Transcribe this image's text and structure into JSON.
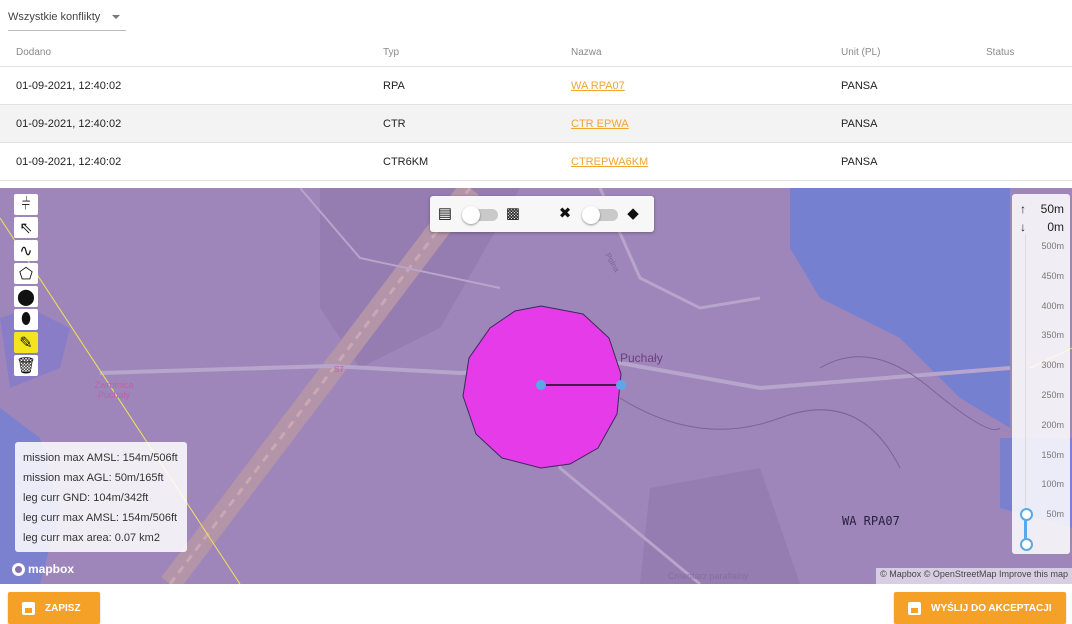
{
  "filter": {
    "label": "Wszystkie konflikty"
  },
  "table": {
    "headers": [
      "Dodano",
      "Typ",
      "Nazwa",
      "Unit (PL)",
      "Status"
    ],
    "rows": [
      {
        "date": "01-09-2021, 12:40:02",
        "type": "RPA",
        "name": "WA RPA07",
        "unit": "PANSA",
        "status": ""
      },
      {
        "date": "01-09-2021, 12:40:02",
        "type": "CTR",
        "name": "CTR EPWA",
        "unit": "PANSA",
        "status": ""
      },
      {
        "date": "01-09-2021, 12:40:02",
        "type": "CTR6KM",
        "name": "CTREPWA6KM",
        "unit": "PANSA",
        "status": ""
      }
    ]
  },
  "map": {
    "tools": [
      "tag-icon",
      "pointer-icon",
      "line-icon",
      "polygon-icon",
      "circle-icon",
      "capsule-icon",
      "edit-icon",
      "trash-icon"
    ],
    "active_tool": "edit-icon",
    "top_controls": [
      "map-icon",
      "satellite-icon",
      "layers-off-icon",
      "layers-icon"
    ],
    "labels": {
      "place": "Puchały",
      "airspace": "WA RPA07",
      "lake": "Zwrotnica Puchały",
      "cemetery": "Cmentarz parafialny",
      "road": "S7",
      "street": "Polna"
    },
    "altitude": {
      "top": "50m",
      "bottom": "0m",
      "ticks": [
        "500m",
        "450m",
        "400m",
        "350m",
        "300m",
        "250m",
        "200m",
        "150m",
        "100m",
        "50m"
      ],
      "selected_max": 50,
      "selected_min": 0,
      "max": 500
    },
    "info": [
      "mission max AMSL: 154m/506ft",
      "mission max AGL: 50m/165ft",
      "leg curr GND: 104m/342ft",
      "leg curr max AMSL: 154m/506ft",
      "leg curr max area: 0.07 km2"
    ],
    "logo": "mapbox",
    "attribution": [
      "© Mapbox",
      "© OpenStreetMap",
      "Improve this map"
    ],
    "colors": {
      "zone": "#e53be8",
      "water": "#6f7fd4",
      "base": "#9e86ba",
      "selection": "#5aa9e6"
    }
  },
  "buttons": {
    "save": "ZAPISZ",
    "submit": "WYŚLIJ DO AKCEPTACJI",
    "accent": "#f5a128"
  }
}
